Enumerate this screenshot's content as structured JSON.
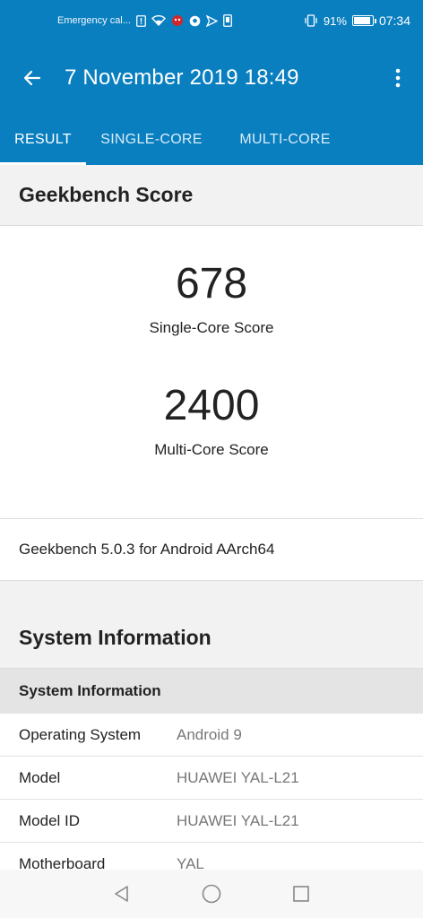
{
  "status_bar": {
    "carrier": "Emergency cal...",
    "battery_pct": "91%",
    "time": "07:34",
    "battery_level": 0.91
  },
  "app_bar": {
    "title": "7 November 2019 18:49",
    "back_icon": "arrow-left-icon",
    "more_icon": "more-vertical-icon"
  },
  "tabs": [
    {
      "label": "RESULT",
      "active": true
    },
    {
      "label": "SINGLE-CORE",
      "active": false
    },
    {
      "label": "MULTI-CORE",
      "active": false
    }
  ],
  "score_section": {
    "title": "Geekbench Score",
    "single_core": {
      "value": "678",
      "label": "Single-Core Score"
    },
    "multi_core": {
      "value": "2400",
      "label": "Multi-Core Score"
    },
    "version": "Geekbench 5.0.3 for Android AArch64"
  },
  "system_info": {
    "title": "System Information",
    "subheader": "System Information",
    "rows": [
      {
        "key": "Operating System",
        "value": "Android 9"
      },
      {
        "key": "Model",
        "value": "HUAWEI YAL-L21"
      },
      {
        "key": "Model ID",
        "value": "HUAWEI YAL-L21"
      },
      {
        "key": "Motherboard",
        "value": "YAL"
      }
    ]
  },
  "colors": {
    "primary": "#0a7fc0",
    "background": "#f2f2f2",
    "text": "#222222",
    "muted": "#777777"
  }
}
